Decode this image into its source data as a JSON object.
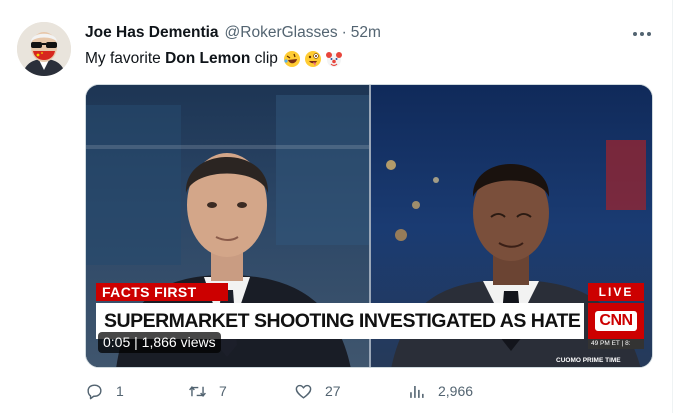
{
  "tweet": {
    "display_name": "Joe Has Dementia",
    "handle": "@RokerGlasses",
    "separator": "·",
    "time": "52m",
    "text_before": "My favorite ",
    "text_bold": "Don Lemon",
    "text_after": " clip",
    "emojis": [
      "rolling-on-floor-laughing-emoji",
      "zany-face-emoji",
      "clown-face-emoji"
    ],
    "more_icon": "more-horizontal-icon"
  },
  "video": {
    "facts_label": "FACTS FIRST",
    "headline": "SUPERMARKET SHOOTING INVESTIGATED AS HATE CRIME",
    "live_label": "LIVE",
    "network_logo": "CNN",
    "time_bug": "49 PM ET | 8:",
    "show_tag": "CUOMO PRIME TIME",
    "stats": "0:05 | 1,866 views"
  },
  "actions": {
    "reply": {
      "icon": "reply-icon",
      "count": "1"
    },
    "retweet": {
      "icon": "retweet-icon",
      "count": "7"
    },
    "like": {
      "icon": "heart-icon",
      "count": "27"
    },
    "views": {
      "icon": "analytics-icon",
      "count": "2,966"
    }
  },
  "colors": {
    "text_primary": "#0f1419",
    "text_secondary": "#536471",
    "cnn_red": "#cc0000"
  }
}
